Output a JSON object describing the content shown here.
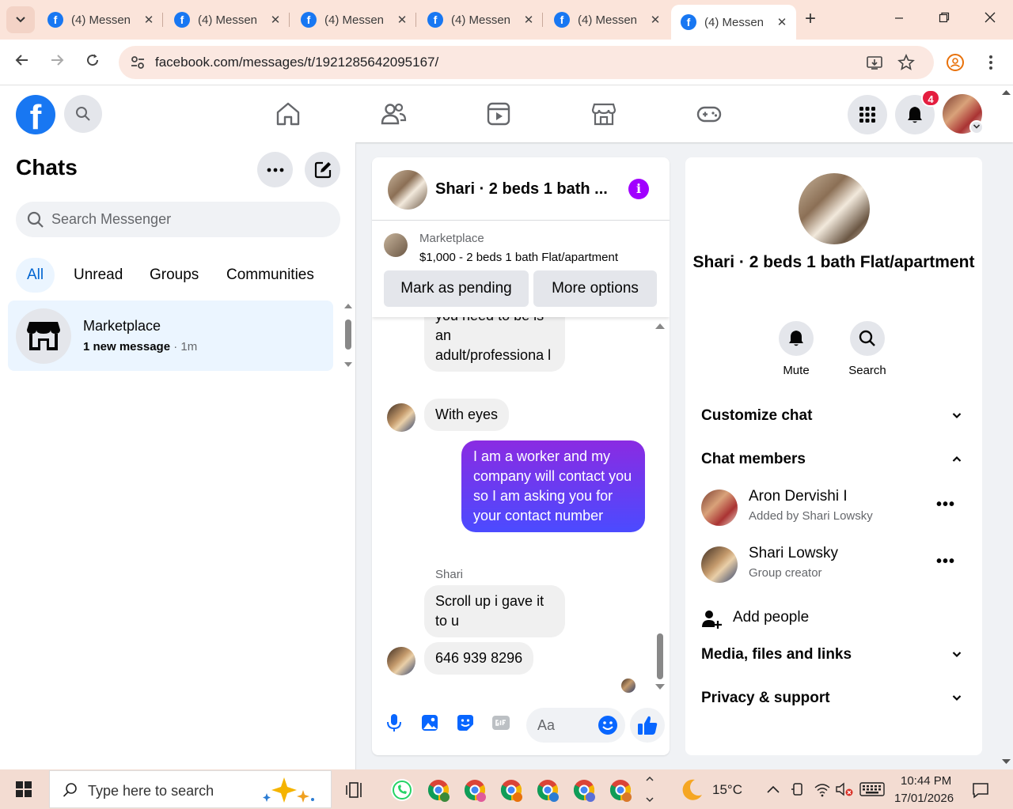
{
  "browser": {
    "tabs": [
      {
        "title": "(4) Messen"
      },
      {
        "title": "(4) Messen"
      },
      {
        "title": "(4) Messen"
      },
      {
        "title": "(4) Messen"
      },
      {
        "title": "(4) Messen"
      },
      {
        "title": "(4) Messen"
      }
    ],
    "close_glyph": "✕",
    "new_tab_glyph": "+",
    "url": "facebook.com/messages/t/1921285642095167/"
  },
  "header": {
    "notification_count": "4",
    "logo_letter": "f"
  },
  "chats": {
    "title": "Chats",
    "search_placeholder": "Search Messenger",
    "filters": [
      "All",
      "Unread",
      "Groups",
      "Communities"
    ],
    "items": [
      {
        "name": "Marketplace",
        "preview": "1 new message",
        "sep": " · ",
        "time": "1m"
      }
    ]
  },
  "conversation": {
    "title": "Shari · 2 beds 1 bath ...",
    "info_glyph": "i",
    "marketplace_label": "Marketplace",
    "listing": "$1,000 - 2 beds 1 bath Flat/apartment",
    "mark_pending": "Mark as pending",
    "more_options": "More options",
    "messages": {
      "m1": "you need to be is an adult/professiona l",
      "m2": "With eyes",
      "m3": "I am a worker and my company will contact you so I am asking you for your contact number",
      "sender": "Shari",
      "m4": "Scroll up i gave it to u",
      "m5": "646 939 8296"
    },
    "input_placeholder": "Aa"
  },
  "info": {
    "name": "Shari · 2 beds 1 bath Flat/apartment",
    "actions": {
      "mute": "Mute",
      "search": "Search"
    },
    "sections": {
      "customize": "Customize chat",
      "members": "Chat members",
      "media": "Media, files and links",
      "privacy": "Privacy & support"
    },
    "members": [
      {
        "name": "Aron Dervishi I",
        "sub": "Added by Shari Lowsky"
      },
      {
        "name": "Shari Lowsky",
        "sub": "Group creator"
      }
    ],
    "add_people": "Add people",
    "more_glyph": "•••"
  },
  "taskbar": {
    "search_placeholder": "Type here to search",
    "weather": "15°C",
    "time": "10:44 PM",
    "date": "17/01/2026"
  }
}
